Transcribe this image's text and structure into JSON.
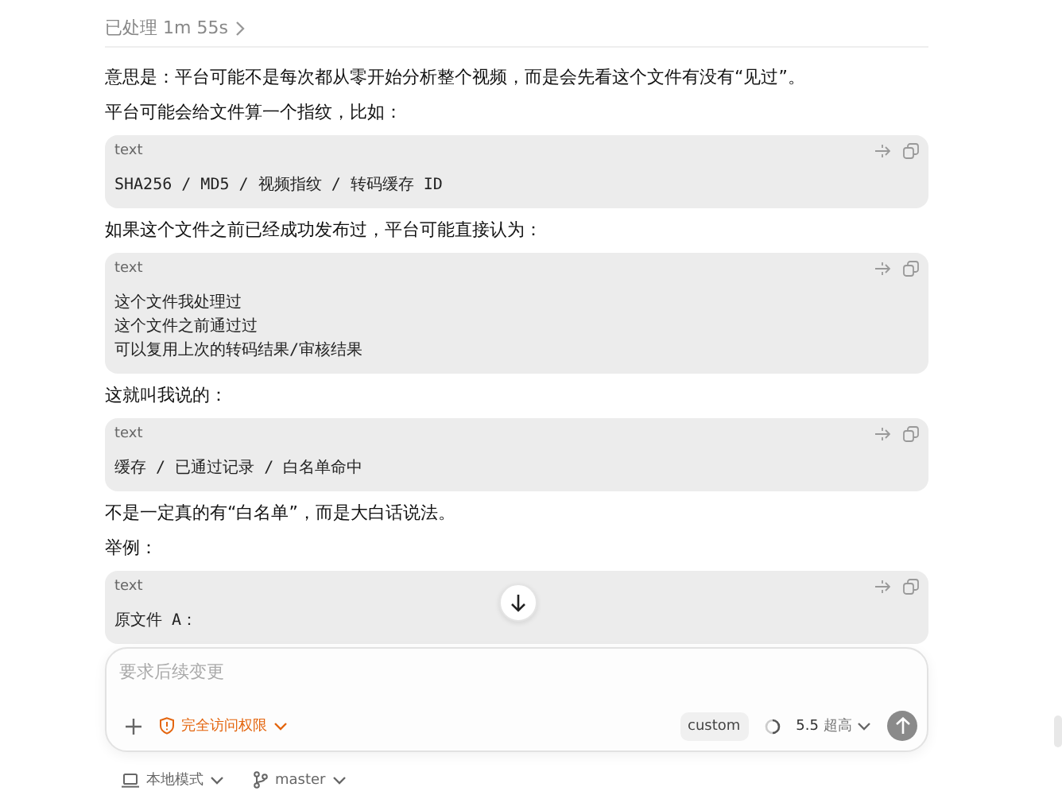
{
  "header": {
    "label": "已处理 1m 55s"
  },
  "blocks": [
    {
      "kind": "paragraph",
      "text": "意思是：平台可能不是每次都从零开始分析整个视频，而是会先看这个文件有没有“见过”。"
    },
    {
      "kind": "paragraph",
      "text": "平台可能会给文件算一个指纹，比如："
    },
    {
      "kind": "code",
      "language": "text",
      "lines": [
        "SHA256 / MD5 / 视频指纹 / 转码缓存 ID"
      ]
    },
    {
      "kind": "paragraph",
      "text": "如果这个文件之前已经成功发布过，平台可能直接认为："
    },
    {
      "kind": "code",
      "language": "text",
      "lines": [
        "这个文件我处理过",
        "这个文件之前通过过",
        "可以复用上次的转码结果/审核结果"
      ]
    },
    {
      "kind": "paragraph",
      "text": "这就叫我说的："
    },
    {
      "kind": "code",
      "language": "text",
      "lines": [
        "缓存 / 已通过记录 / 白名单命中"
      ]
    },
    {
      "kind": "paragraph",
      "text": "不是一定真的有“白名单”，而是大白话说法。"
    },
    {
      "kind": "paragraph",
      "text": "举例："
    },
    {
      "kind": "code",
      "language": "text",
      "lines": [
        "原文件 A："
      ]
    }
  ],
  "composer": {
    "placeholder": "要求后续变更",
    "permission": "完全访问权限",
    "mode": "custom",
    "model": "5.5",
    "effort": "超高"
  },
  "footer": {
    "mode": "本地模式",
    "branch": "master"
  }
}
